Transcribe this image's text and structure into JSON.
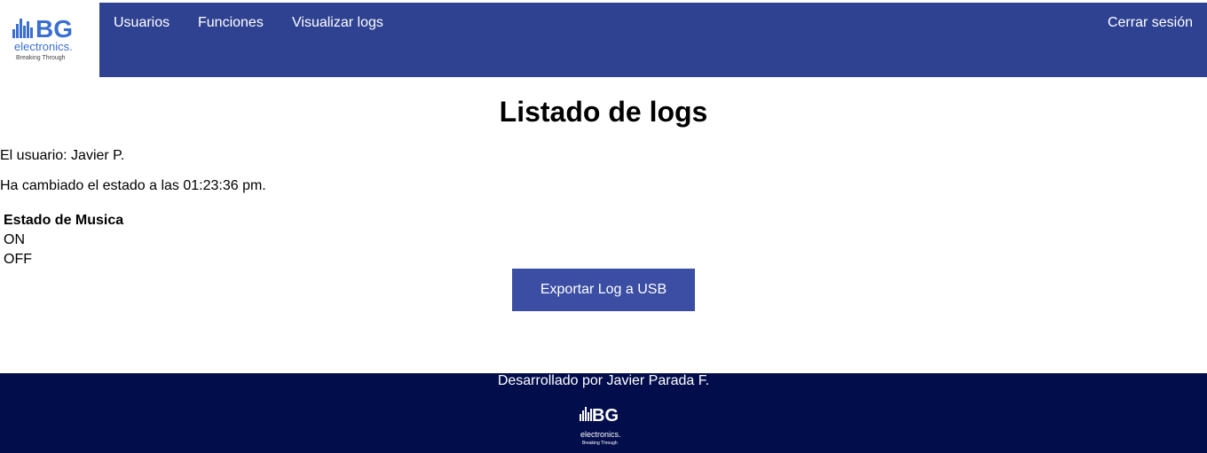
{
  "colors": {
    "topbar": "#2f4291",
    "button": "#3b4ea3",
    "footer": "#020d4c",
    "logo_blue": "#3a6fd1"
  },
  "header": {
    "logo": {
      "icon": "bg-electronics-logo",
      "brand_mark": "BG",
      "brand_text": "electronics.",
      "tagline": "Breaking Through"
    },
    "nav": {
      "usuarios": "Usuarios",
      "funciones": "Funciones",
      "logs": "Visualizar logs"
    },
    "logout": "Cerrar sesión"
  },
  "main": {
    "title": "Listado de logs",
    "user_line": "El usuario: Javier P.",
    "change_line": "Ha cambiado el estado a las 01:23:36 pm.",
    "state_table": {
      "header": "Estado de Musica",
      "rows": [
        "ON",
        "OFF"
      ]
    },
    "export_button": "Exportar Log a USB"
  },
  "footer": {
    "credit": "Desarrollado por Javier Parada F.",
    "logo": {
      "icon": "bg-electronics-logo-white",
      "brand_mark": "BG",
      "brand_text": "electronics.",
      "tagline": "Breaking Through"
    }
  }
}
